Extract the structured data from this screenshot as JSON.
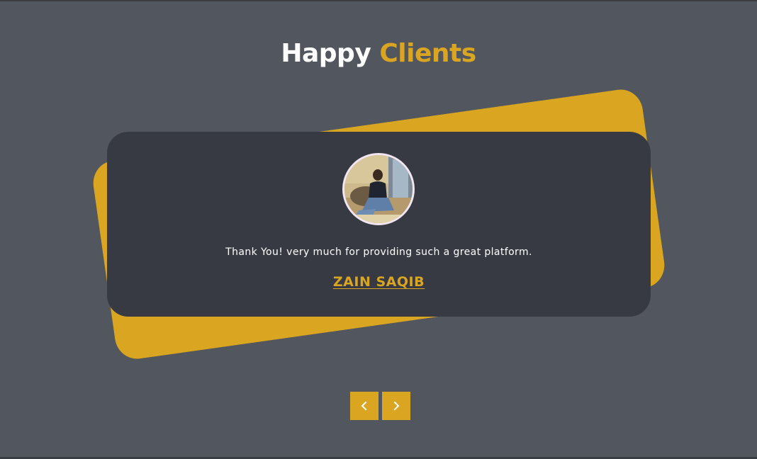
{
  "heading": {
    "word1": "Happy",
    "word2": "Clients"
  },
  "testimonial": {
    "quote": "Thank You! very much for providing such a great platform.",
    "client_name": "ZAIN SAQIB"
  },
  "navigation": {
    "prev_icon": "chevron-left-icon",
    "next_icon": "chevron-right-icon"
  },
  "colors": {
    "accent": "#daa520",
    "page_background": "#52565e",
    "card_background": "#373a42",
    "text": "#ffffff"
  }
}
